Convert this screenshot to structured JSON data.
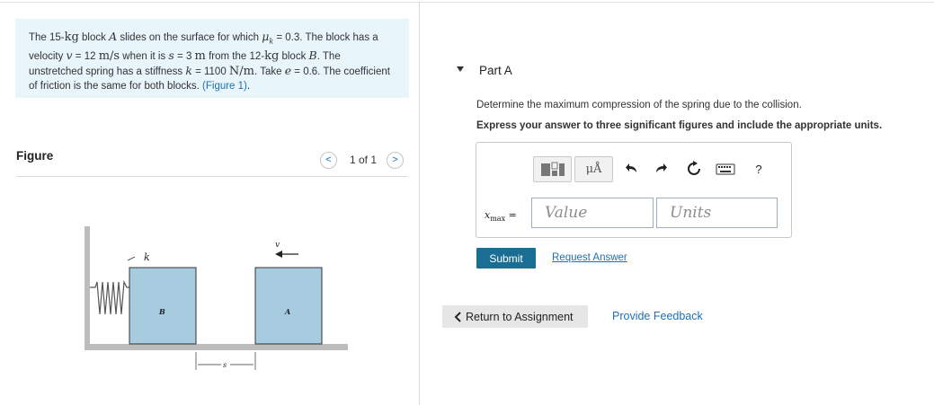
{
  "problem": {
    "t1": "The 15-",
    "kg1": "kg",
    "t2": " block ",
    "A1": "A",
    "t3": " slides on the surface for which ",
    "mu": "μ",
    "mu_sub": "k",
    "t4": " = 0.3. The block has a velocity ",
    "v": "v",
    "t5": " = 12 ",
    "ms": "m/s",
    "t6": " when it is ",
    "s": "s",
    "t7": " = 3 ",
    "m": "m",
    "t8": " from the 12-",
    "kg2": "kg",
    "t9": " block ",
    "B1": "B",
    "t10": ". The unstretched spring has a stiffness ",
    "k": "k",
    "t11": " = 1100 ",
    "Nm": "N/m",
    "t12": ". Take ",
    "e": "e",
    "t13": " = 0.6. The coefficient of friction is the same for both blocks. ",
    "figure_link": "(Figure 1)",
    "t14": "."
  },
  "figure_panel": {
    "title": "Figure",
    "pager_count": "1 of 1",
    "prev_glyph": "<",
    "next_glyph": ">",
    "labels": {
      "k": "k",
      "v": "v",
      "B": "B",
      "A": "A",
      "s": "s"
    }
  },
  "part": {
    "title": "Part A",
    "question": "Determine the maximum compression of the spring due to the collision.",
    "instruction": "Express your answer to three significant figures and include the appropriate units.",
    "toolbar": {
      "units_glyph": "μÅ",
      "help_glyph": "?"
    },
    "var_label": "x",
    "var_sub": "max",
    "equals": " =",
    "value_placeholder": "Value",
    "units_placeholder": "Units",
    "submit_label": "Submit",
    "request_answer_label": "Request Answer"
  },
  "footer": {
    "return_label": "Return to Assignment",
    "feedback_label": "Provide Feedback"
  },
  "colors": {
    "accent_link": "#1f6fb2",
    "submit_bg": "#1a6e93",
    "problem_bg": "#e8f5fa",
    "block_fill": "#a7cce0"
  }
}
